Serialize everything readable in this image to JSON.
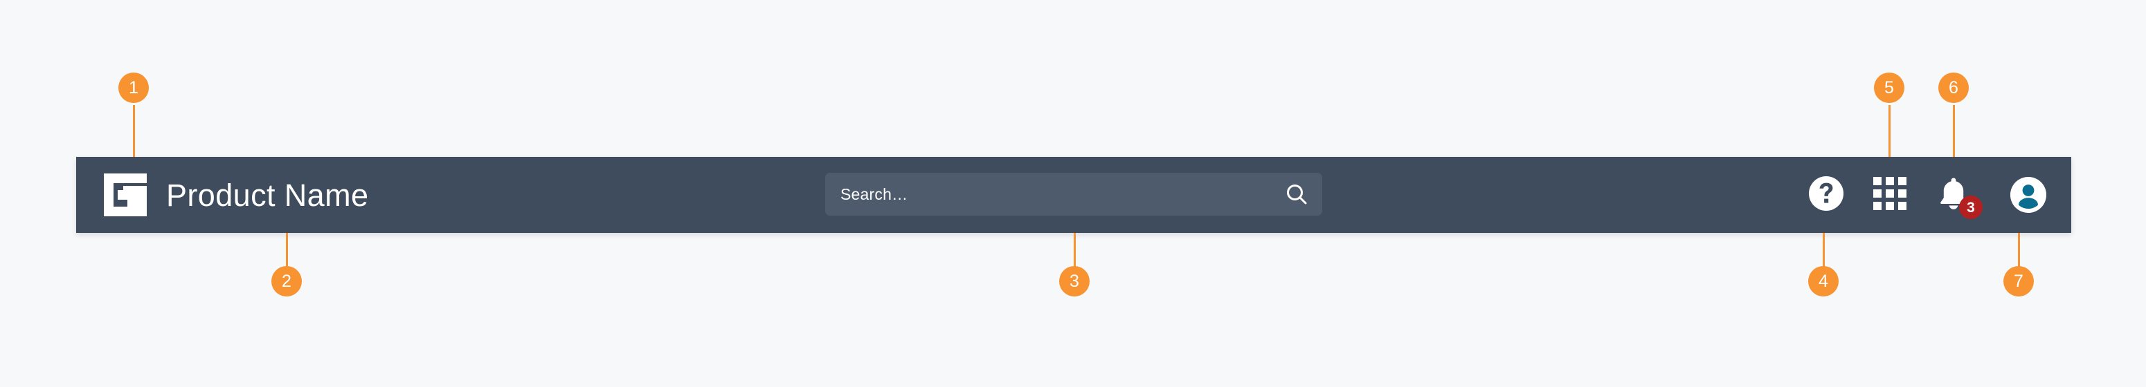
{
  "page": {
    "background_color": "#f7f8fa",
    "accent_color": "#f79331",
    "bar_color": "#3e4c5e",
    "search_field_color": "#4d5b6d",
    "badge_color": "#b3201f",
    "avatar_glyph_color": "#0b6e90"
  },
  "header": {
    "logo": {
      "icon": "square-spiral-g-logo",
      "color": "#ffffff"
    },
    "title": "Product Name",
    "search": {
      "placeholder": "Search…",
      "value": "",
      "icon": "search-icon"
    },
    "actions": [
      {
        "id": "help",
        "icon": "help-circle-icon",
        "label": "Help"
      },
      {
        "id": "app-launcher",
        "icon": "grid-apps-icon",
        "label": "App Launcher"
      },
      {
        "id": "notifications",
        "icon": "bell-icon",
        "label": "Notifications",
        "badge": "3"
      },
      {
        "id": "profile",
        "icon": "user-avatar-icon",
        "label": "Profile"
      }
    ]
  },
  "callouts": [
    {
      "number": "1",
      "target": "logo",
      "position": "above"
    },
    {
      "number": "2",
      "target": "product-title",
      "position": "below"
    },
    {
      "number": "3",
      "target": "search-box",
      "position": "below"
    },
    {
      "number": "4",
      "target": "help-button",
      "position": "below"
    },
    {
      "number": "5",
      "target": "app-launcher",
      "position": "above"
    },
    {
      "number": "6",
      "target": "notifications",
      "position": "above"
    },
    {
      "number": "7",
      "target": "profile-avatar",
      "position": "below"
    }
  ]
}
